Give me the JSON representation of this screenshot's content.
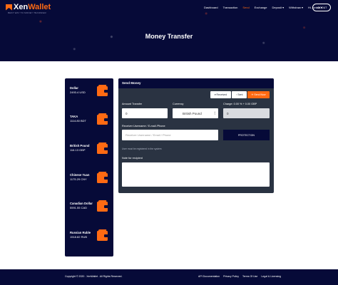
{
  "brand": {
    "name_main": "Xen",
    "name_accent": "Wallet",
    "tagline": "BEST WAY TO MONEY TRANSFER"
  },
  "nav": {
    "items": [
      "Dashboard",
      "Transaction",
      "Send",
      "Exchange",
      "Deposit ▾",
      "Withdraw ▾",
      "Hi, ronnie ▾"
    ],
    "active_index": 2,
    "logout_label": "LOGOUT"
  },
  "page_title": "Money Transfer",
  "balances": [
    {
      "name": "Dollar",
      "amount": "2493.4 USD"
    },
    {
      "name": "TAKA",
      "amount": "1114.80 BDT"
    },
    {
      "name": "British Pound",
      "amount": "116.13 GBP"
    },
    {
      "name": "Chinese Yuan",
      "amount": "1175.29 CNY"
    },
    {
      "name": "Canadian Dollar",
      "amount": "5591.55 CAD"
    },
    {
      "name": "Russian Ruble",
      "amount": "1518.82 RUB"
    }
  ],
  "send_panel": {
    "title": "Send Money",
    "buttons": {
      "received": "▾ Received",
      "sent": "↑ Sent",
      "send_now": "✈ Send Now"
    },
    "amount_label": "Amount Transfer",
    "amount_value": "0",
    "currency_label": "Currency",
    "currency_value": "British Pound",
    "charge_label": "Charge: 0.00 % + 0.00 GBP",
    "charge_value": "0",
    "receiver_label": "Receiver Username / E-mail /Phone",
    "receiver_placeholder": "Receiver Username / Email / Phone",
    "protection_label": "PROTECTION",
    "hint": "User must be registered in the system",
    "note_label": "Note for recipient"
  },
  "footer": {
    "copyright": "Copyright © 2020 . XenWallet . All Rights Reserved.",
    "links": [
      "API Documentation",
      "Privacy Policy",
      "Terms Of Use",
      "Legal & Licensing"
    ]
  },
  "colors": {
    "navy": "#060a38",
    "accent": "#ff6a13",
    "panel": "#2a3342"
  }
}
